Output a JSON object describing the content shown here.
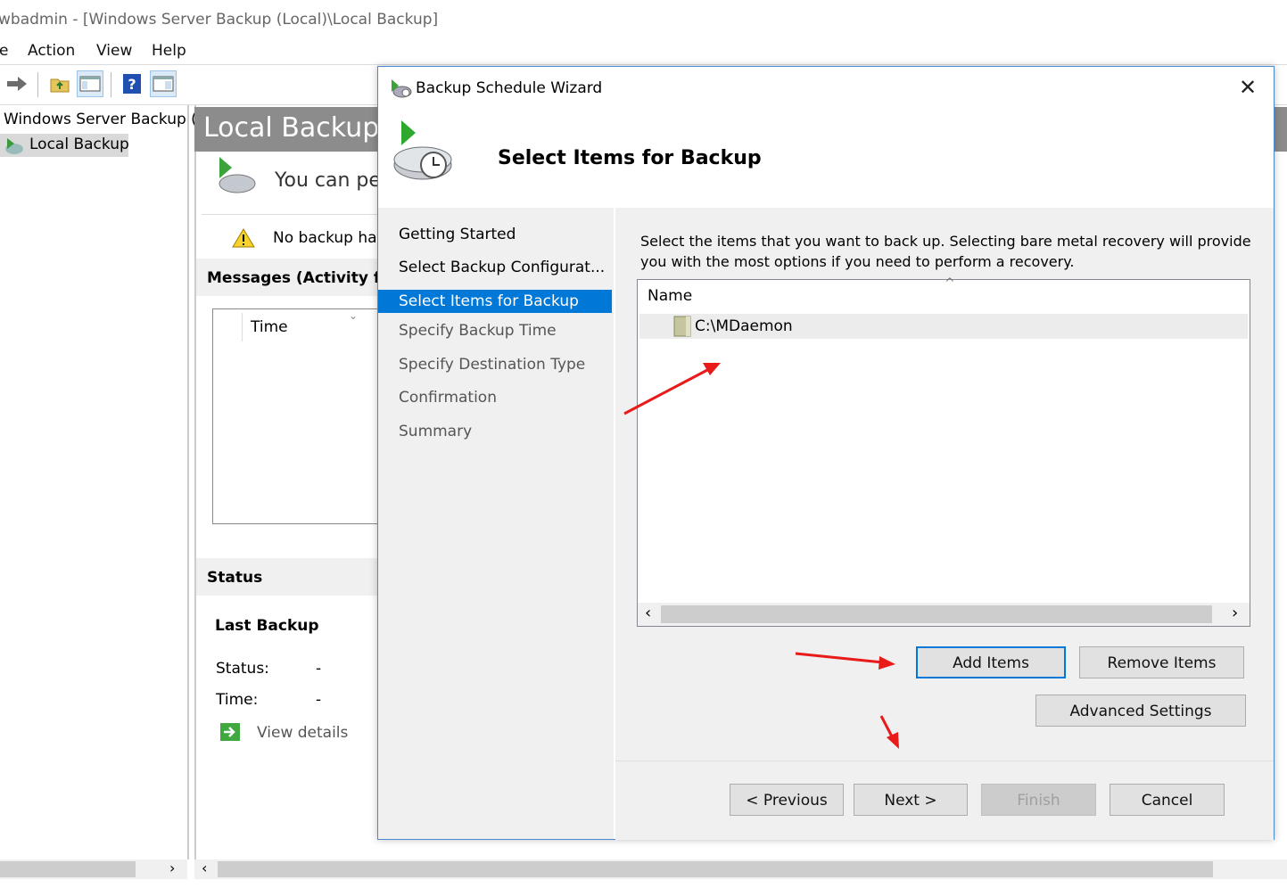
{
  "window": {
    "title": "wbadmin - [Windows Server Backup (Local)\\Local Backup]"
  },
  "menu": [
    "File",
    "Action",
    "View",
    "Help"
  ],
  "menu_visible": [
    "e",
    "Action",
    "View",
    "Help"
  ],
  "toolbar": {
    "icons": [
      "forward-icon",
      "folder-up-icon",
      "console-tree-icon",
      "help-icon",
      "properties-icon"
    ]
  },
  "tree": {
    "root": "Windows Server Backup (L",
    "child": "Local Backup"
  },
  "center": {
    "header": "Local Backup",
    "intro": "You can per",
    "warning": "No backup has",
    "messages_title": "Messages (Activity fro",
    "messages_col": "Time",
    "status_title": "Status",
    "last_backup": "Last Backup",
    "status_label": "Status:",
    "status_value": "-",
    "time_label": "Time:",
    "time_value": "-",
    "view_details": "View details"
  },
  "wizard": {
    "title": "Backup Schedule Wizard",
    "heading": "Select Items for Backup",
    "close": "✕",
    "steps": [
      "Getting Started",
      "Select Backup Configurat...",
      "Select Items for Backup",
      "Specify Backup Time",
      "Specify Destination Type",
      "Confirmation",
      "Summary"
    ],
    "active_step": 2,
    "description_line1": "Select the items that you want to back up. Selecting bare metal recovery will provide",
    "description_line2": "you with the most options if you need to perform a recovery.",
    "list_header": "Name",
    "items": [
      "C:\\MDaemon"
    ],
    "buttons": {
      "add": "Add Items",
      "remove": "Remove Items",
      "advanced": "Advanced Settings",
      "previous": "< Previous",
      "next": "Next >",
      "finish": "Finish",
      "cancel": "Cancel"
    }
  },
  "colors": {
    "accent": "#0078d7",
    "annotation": "#e81a1a",
    "header_gray": "#8c8c8c"
  }
}
